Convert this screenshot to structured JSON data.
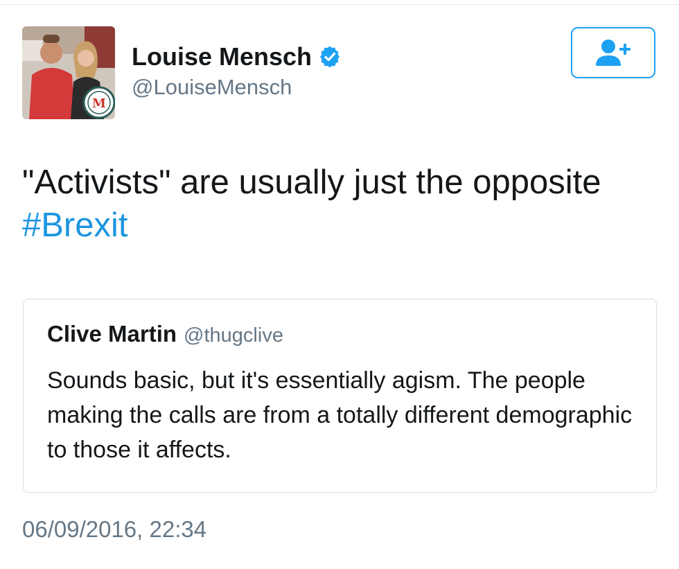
{
  "tweet": {
    "author": {
      "display_name": "Louise Mensch",
      "handle": "@LouiseMensch",
      "verified": true,
      "verified_icon": "verified-badge-icon",
      "avatar_badge_letter": "M"
    },
    "follow_button": {
      "icon": "add-user-icon"
    },
    "text": {
      "body": "\"Activists\" are usually just the opposite",
      "hashtag": "#Brexit"
    },
    "quoted_tweet": {
      "author_name": "Clive Martin",
      "author_handle": "@thugclive",
      "text": "Sounds basic, but it's essentially agism. The people making the calls are from a totally different demographic to those it affects."
    },
    "timestamp": "06/09/2016, 22:34"
  },
  "colors": {
    "accent": "#1da1f2",
    "link": "#1b95e0",
    "text_primary": "#14171a",
    "text_secondary": "#657786",
    "border": "#d6dde3"
  }
}
